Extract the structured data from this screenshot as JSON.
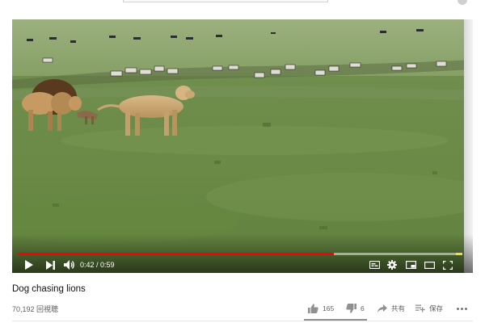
{
  "video": {
    "title": "Dog chasing lions",
    "views": "70,192 回視聴",
    "time_current": "0:42",
    "time_separator": " / ",
    "time_total": "0:59",
    "progress_fraction": 0.71,
    "loaded_fraction": 1.0
  },
  "actions": {
    "like_count": "165",
    "dislike_count": "6",
    "share_label": "共有",
    "save_label": "保存"
  },
  "icons": {
    "play": "play-icon",
    "next": "next-icon",
    "volume": "volume-icon",
    "subtitles": "subtitles-icon",
    "settings": "gear-icon",
    "miniplayer": "miniplayer-icon",
    "theater": "theater-mode-icon",
    "fullscreen": "fullscreen-icon",
    "like": "thumbs-up-icon",
    "dislike": "thumbs-down-icon",
    "share": "share-icon",
    "save": "save-playlist-icon",
    "more": "more-icon"
  },
  "colors": {
    "progress_played": "#ff0000",
    "text_primary": "#111111",
    "text_secondary": "#606060"
  }
}
